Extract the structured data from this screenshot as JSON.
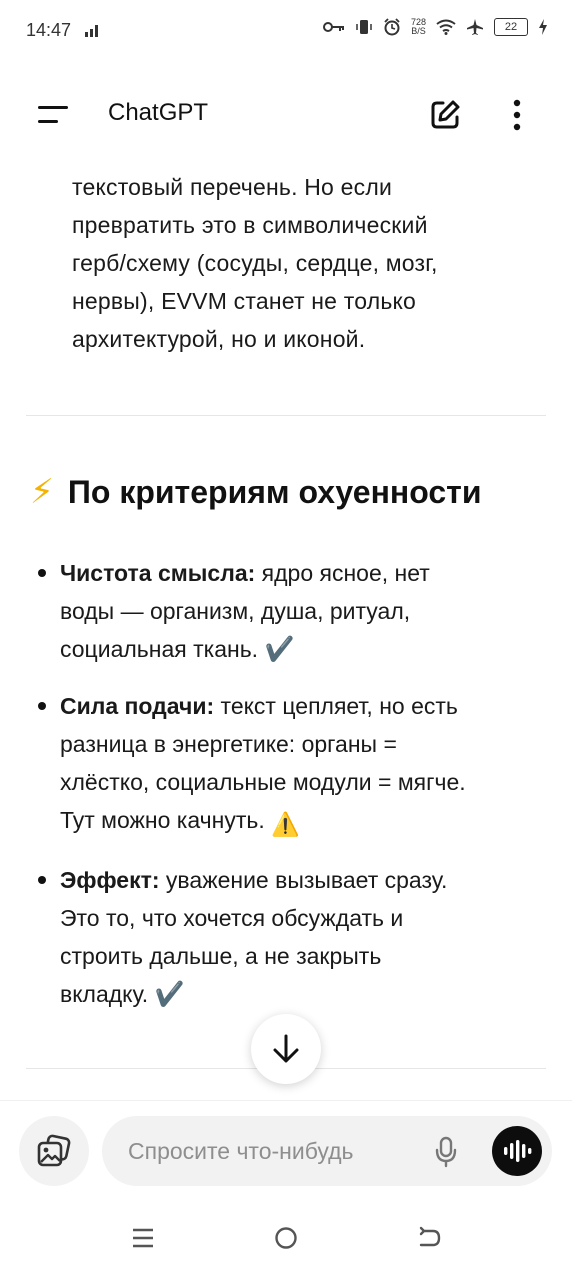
{
  "status": {
    "time": "14:47",
    "net_speed_value": "728",
    "net_speed_unit": "B/S",
    "battery": "22"
  },
  "header": {
    "title": "ChatGPT",
    "icons": [
      "menu-icon",
      "new-chat-edit-icon",
      "more-vert-icon"
    ]
  },
  "message": {
    "paragraph_lines": [
      "текстовый перечень. Но если",
      "превратить это в символический",
      "герб/схему (сосуды, сердце, мозг,",
      "нервы), EVVM станет не только",
      "архитектурой, но и иконой."
    ],
    "heading_emoji": "⚡",
    "heading": "По критериям охуенности",
    "bullets": [
      {
        "label": "Чистота смысла:",
        "lines": [
          " ядро ясное, нет",
          "воды — организм, душа, ритуал,",
          "социальная ткань. "
        ],
        "emoji": "✔️"
      },
      {
        "label": "Сила подачи:",
        "lines": [
          " текст цепляет, но есть",
          "разница в энергетике: органы =",
          "хлёстко, социальные модули = мягче.",
          "Тут можно качнуть. "
        ],
        "emoji": "⚠️"
      },
      {
        "label": "Эффект:",
        "lines": [
          " уважение вызывает сразу.",
          "Это то, что хочется обсуждать и",
          "строить дальше, а не закрыть",
          "вкладку. "
        ],
        "emoji": "✔️"
      }
    ]
  },
  "composer": {
    "placeholder": "Спросите что-нибудь"
  },
  "nav": {
    "icons": [
      "recents-icon",
      "home-icon",
      "back-icon"
    ]
  }
}
